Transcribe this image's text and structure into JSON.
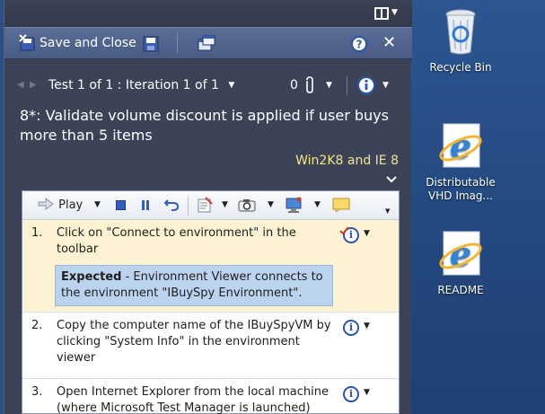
{
  "toolbar": {
    "save_close_label": "Save and Close"
  },
  "nav": {
    "progress": "Test 1 of 1 : Iteration 1 of 1",
    "attachment_count": "0"
  },
  "test_case": {
    "title": "8*: Validate volume discount is applied if user buys more than 5 items",
    "configuration": "Win2K8 and IE 8"
  },
  "steps_toolbar": {
    "play_label": "Play"
  },
  "steps": [
    {
      "number": "1.",
      "text": "Click on \"Connect to environment\" in the toolbar",
      "expected_label": "Expected",
      "expected_text": " - Environment Viewer connects to the environment \"IBuySpy Environment\"."
    },
    {
      "number": "2.",
      "text": "Copy the computer name of the IBuySpyVM by clicking \"System Info\" in the environment viewer"
    },
    {
      "number": "3.",
      "text": "Open Internet Explorer from the local machine (where Microsoft Test Manager is launched)"
    }
  ],
  "desktop": {
    "icons": [
      {
        "label": "Recycle Bin"
      },
      {
        "label": "Distributable VHD Imag..."
      },
      {
        "label": "README"
      }
    ]
  },
  "colors": {
    "panel_bg": "#3d4357",
    "toolbar_bg": "#4a5c86",
    "desktop_bg": "#2a4f86",
    "expected_bg": "#bcd3ef",
    "config_text": "#f2e48a"
  }
}
